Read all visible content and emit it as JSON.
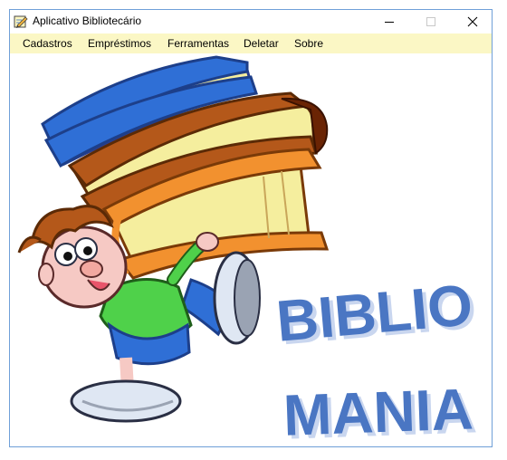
{
  "window": {
    "title": "Aplicativo Bibliotecário",
    "controls": [
      "minimize-icon",
      "maximize-icon",
      "close-icon"
    ]
  },
  "menu": {
    "items": [
      {
        "label": "Cadastros"
      },
      {
        "label": "Empréstimos"
      },
      {
        "label": "Ferramentas"
      },
      {
        "label": "Deletar"
      },
      {
        "label": "Sobre"
      }
    ]
  },
  "splash": {
    "line1": "BIBLIO",
    "line2": "MANIA"
  },
  "colors": {
    "menubar": "#fbf7c5",
    "window_border": "#6f9fd8",
    "banner_text": "#4a76c3"
  }
}
